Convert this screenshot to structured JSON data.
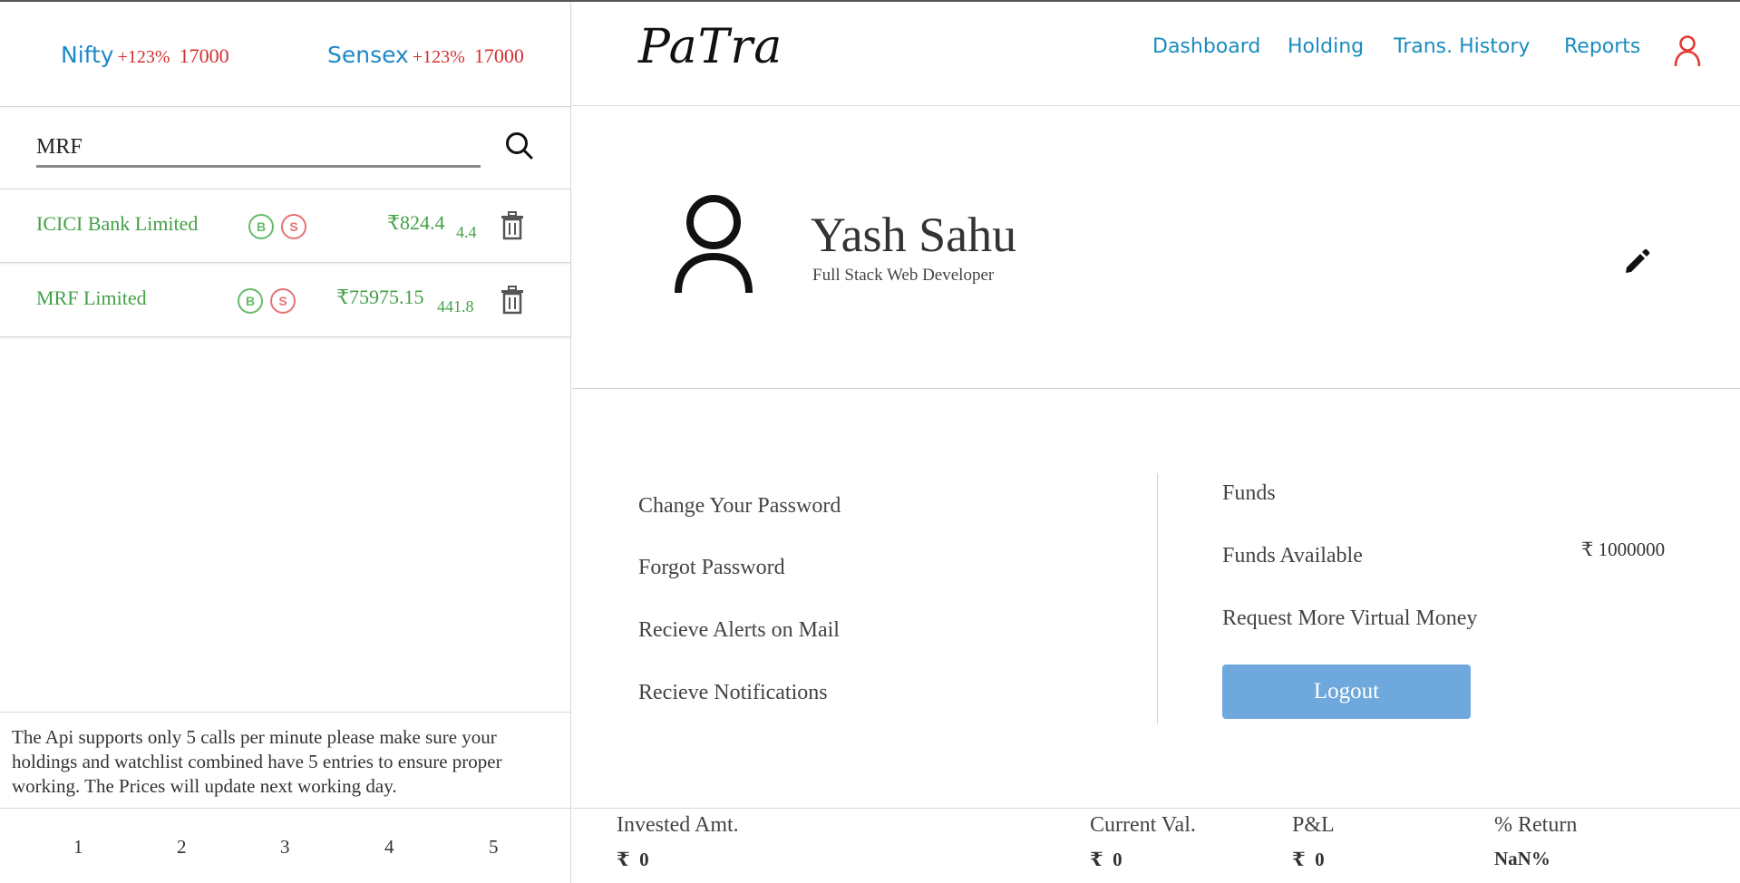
{
  "tickers": [
    {
      "name": "Nifty",
      "change": "+123%",
      "value": "17000"
    },
    {
      "name": "Sensex",
      "change": "+123%",
      "value": "17000"
    }
  ],
  "search": {
    "value": "MRF",
    "placeholder": "Search"
  },
  "watchlist": [
    {
      "name": "ICICI Bank Limited",
      "buy": "B",
      "sell": "S",
      "price": "₹824.4",
      "change": "4.4"
    },
    {
      "name": "MRF Limited",
      "buy": "B",
      "sell": "S",
      "price": "₹75975.15",
      "change": "441.8"
    }
  ],
  "note": "The Api supports only 5 calls per minute please make sure your holdings and watchlist combined have 5 entries to ensure proper working. The Prices will update next working day.",
  "pagination": [
    "1",
    "2",
    "3",
    "4",
    "5"
  ],
  "brand": "PaTra",
  "nav": [
    "Dashboard",
    "Holding",
    "Trans. History",
    "Reports"
  ],
  "profile": {
    "name": "Yash Sahu",
    "role": "Full Stack Web Developer"
  },
  "options": [
    "Change Your Password",
    "Forgot Password",
    "Recieve Alerts on Mail",
    "Recieve Notifications"
  ],
  "funds": {
    "title": "Funds",
    "available_label": "Funds Available",
    "available_value": "₹ 1000000",
    "request": "Request More Virtual Money",
    "logout": "Logout"
  },
  "stats": [
    {
      "label": "Invested Amt.",
      "value": "₹  0"
    },
    {
      "label": "Current Val.",
      "value": "₹  0"
    },
    {
      "label": "P&L",
      "value": "₹  0"
    },
    {
      "label": "% Return",
      "value": "NaN%"
    }
  ],
  "colors": {
    "link": "#1a8cbf",
    "positive": "#43a047",
    "negative": "#d32f2f",
    "logout_button": "#6fa8dc"
  }
}
